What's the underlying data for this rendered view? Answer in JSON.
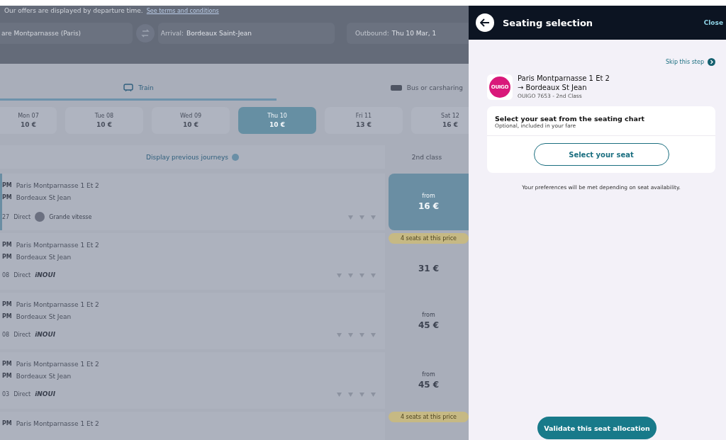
{
  "background": {
    "notice": {
      "text": "Our offers are displayed by departure time.",
      "link": "See terms and conditions"
    },
    "search": {
      "departure": "are Montparnasse (Paris)",
      "arrival_label": "Arrival:",
      "arrival": "Bordeaux Saint-Jean",
      "outbound_label": "Outbound:",
      "outbound": "Thu 10 Mar, 1"
    },
    "tabs": [
      {
        "label": "Train",
        "selected": true
      },
      {
        "label": "Bus or carsharing",
        "selected": false
      }
    ],
    "dates": [
      {
        "day": "Mon 07",
        "price": "10 €",
        "selected": false
      },
      {
        "day": "Tue 08",
        "price": "10 €",
        "selected": false
      },
      {
        "day": "Wed 09",
        "price": "10 €",
        "selected": false
      },
      {
        "day": "Thu 10",
        "price": "10 €",
        "selected": true
      },
      {
        "day": "Fri 11",
        "price": "13 €",
        "selected": false
      },
      {
        "day": "Sat 12",
        "price": "16 €",
        "selected": false
      }
    ],
    "previous_journeys": "Display previous journeys",
    "class_header": "2nd class",
    "journeys": [
      {
        "dep_time": "PM",
        "dep": "Paris Montparnasse 1 Et 2",
        "arr_time": "PM",
        "arr": "Bordeaux St Jean",
        "duration": "27",
        "type": "Direct",
        "operator": {
          "kind": "badge",
          "text": "Grande vitesse"
        },
        "price_label": "from",
        "price": "16 €",
        "selected": true
      },
      {
        "dep_time": "PM",
        "dep": "Paris Montparnasse 1 Et 2",
        "arr_time": "PM",
        "arr": "Bordeaux St Jean",
        "duration": "08",
        "type": "Direct",
        "operator": {
          "kind": "logo",
          "text": "iNOUI"
        },
        "badge": "4 seats at this price",
        "price": "31 €",
        "selected": false
      },
      {
        "dep_time": "PM",
        "dep": "Paris Montparnasse 1 Et 2",
        "arr_time": "PM",
        "arr": "Bordeaux St Jean",
        "duration": "08",
        "type": "Direct",
        "operator": {
          "kind": "logo",
          "text": "iNOUI"
        },
        "price_label": "from",
        "price": "45 €",
        "selected": false
      },
      {
        "dep_time": "PM",
        "dep": "Paris Montparnasse 1 Et 2",
        "arr_time": "PM",
        "arr": "Bordeaux St Jean",
        "duration": "03",
        "type": "Direct",
        "operator": {
          "kind": "logo",
          "text": "iNOUI"
        },
        "price_label": "from",
        "price": "45 €",
        "selected": false
      },
      {
        "dep_time": "PM",
        "dep": "Paris Montparnasse 1 Et 2",
        "badge": "4 seats at this price",
        "selected": false
      }
    ]
  },
  "panel": {
    "title": "Seating selection",
    "close": "Close",
    "skip": "Skip this step",
    "trip": {
      "logo": "OUIGO",
      "from": "Paris Montparnasse 1 Et 2",
      "to": "→ Bordeaux St Jean",
      "detail": "OUIGO 7653 - 2nd Class"
    },
    "card": {
      "title": "Select your seat from the seating chart",
      "subtitle": "Optional, included in your fare",
      "button": "Select your seat"
    },
    "note": "Your preferences will be met depending on seat availability.",
    "validate": "Validate this seat allocation"
  }
}
